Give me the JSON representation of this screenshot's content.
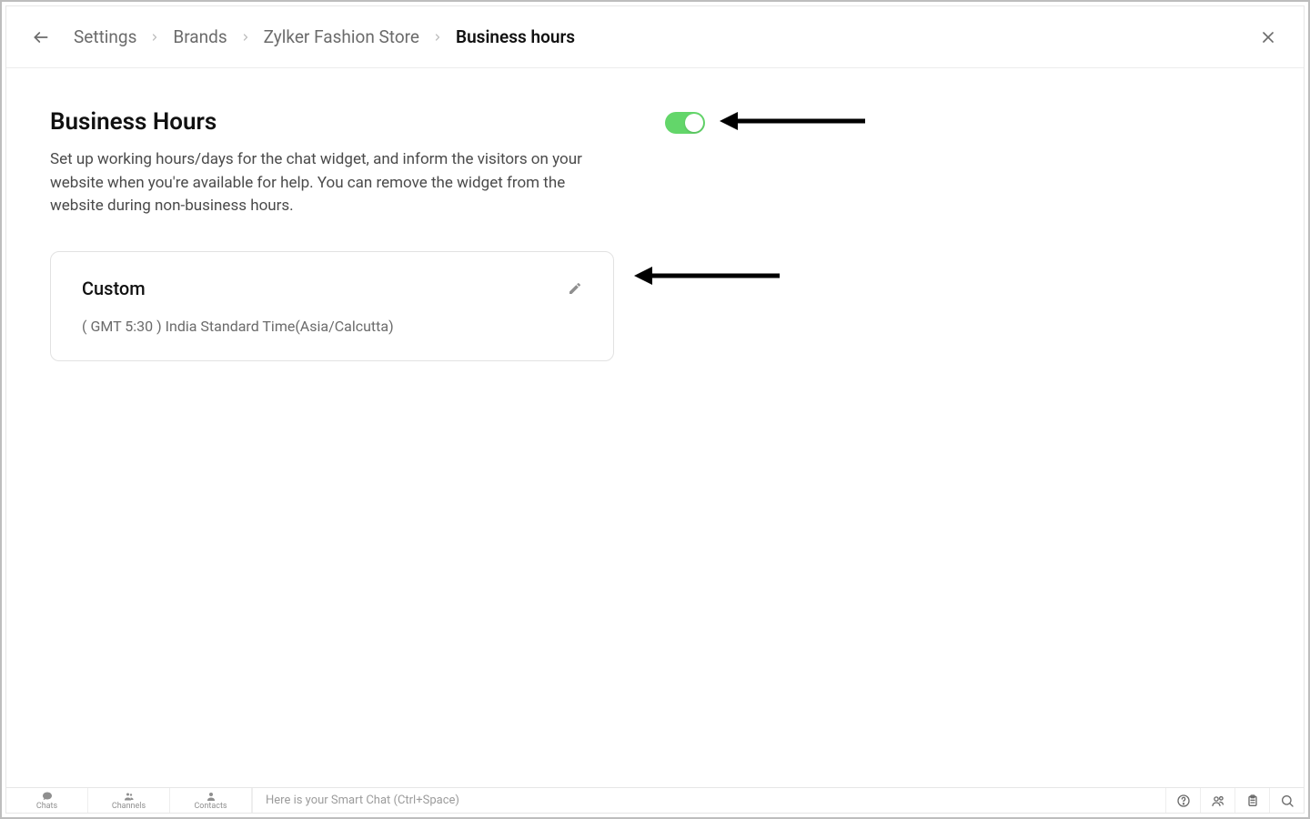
{
  "breadcrumbs": {
    "items": [
      {
        "label": "Settings"
      },
      {
        "label": "Brands"
      },
      {
        "label": "Zylker Fashion Store"
      },
      {
        "label": "Business hours"
      }
    ]
  },
  "section": {
    "title": "Business Hours",
    "description": "Set up working hours/days for the chat widget, and inform the visitors on your website when you're available for help. You can remove the widget from the website during non-business hours."
  },
  "toggle": {
    "on": true
  },
  "card": {
    "title": "Custom",
    "subtitle": "( GMT 5:30 ) India Standard Time(Asia/Calcutta)"
  },
  "bottom": {
    "items": [
      {
        "label": "Chats"
      },
      {
        "label": "Channels"
      },
      {
        "label": "Contacts"
      }
    ],
    "smartchat_placeholder": "Here is your Smart Chat (Ctrl+Space)"
  }
}
